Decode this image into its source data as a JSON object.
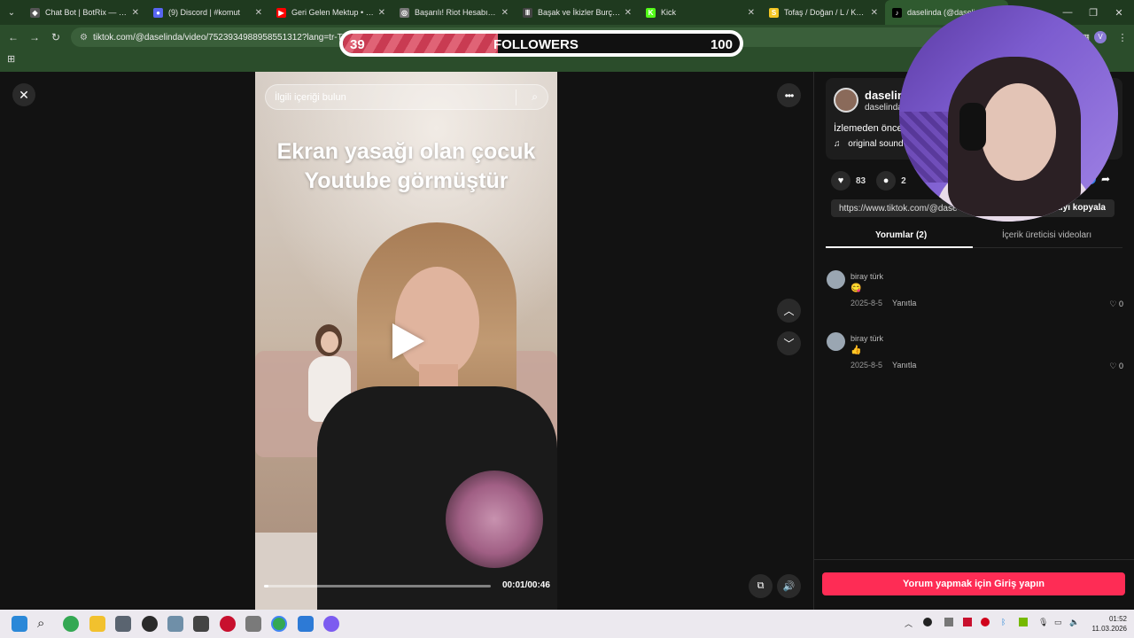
{
  "browser": {
    "tabs": [
      {
        "label": "Chat Bot | BotRix — Clou",
        "fav_color": "#555555",
        "fav_text": "◆"
      },
      {
        "label": "(9) Discord | #komut",
        "fav_color": "#5865f2",
        "fav_text": "●"
      },
      {
        "label": "Geri Gelen Mektup • Gülr",
        "fav_color": "#ff0000",
        "fav_text": "▶"
      },
      {
        "label": "Başarılı! Riot Hesabın Artık",
        "fav_color": "#777777",
        "fav_text": "◎"
      },
      {
        "label": "Başak ve İkizler Burç Uyum",
        "fav_color": "#444444",
        "fav_text": "Ⅲ"
      },
      {
        "label": "Kick",
        "fav_color": "#53fc18",
        "fav_text": "K"
      },
      {
        "label": "Tofaş / Doğan / L / Kusur",
        "fav_color": "#f3c623",
        "fav_text": "S"
      },
      {
        "label": "daselinda (@daselinda)",
        "fav_color": "#000000",
        "fav_text": "♪"
      }
    ],
    "url": "tiktok.com/@daselinda/video/7523934988958551312?lang=tr-TR"
  },
  "followers_goal": {
    "current": "39",
    "label": "FOLLOWERS",
    "goal": "100",
    "progress_fraction": 0.39
  },
  "video": {
    "search_placeholder": "İlgili içeriği bulun",
    "caption_line1": "Ekran yasağı olan çocuk",
    "caption_line2": "Youtube görmüştür",
    "time": "00:01/00:46",
    "progress_fraction": 0.02
  },
  "author": {
    "name": "daselin",
    "handle": "daselinda",
    "description": "İzlemeden önce",
    "sound": "original sound"
  },
  "stats": {
    "likes": "83",
    "comments": "2"
  },
  "link": {
    "url": "https://www.tiktok.com/@dase",
    "copy_label": "ıtıyı kopyala"
  },
  "panel_tabs": {
    "comments": "Yorumlar (2)",
    "creator_videos": "İçerik üreticisi videoları"
  },
  "comments": [
    {
      "author": "biray türk",
      "emoji": "😋",
      "date": "2025-8-5",
      "reply": "Yanıtla",
      "likes": "0"
    },
    {
      "author": "biray türk",
      "emoji": "👍",
      "date": "2025-8-5",
      "reply": "Yanıtla",
      "likes": "0"
    }
  ],
  "login_button": "Yorum yapmak için Giriş yapın",
  "clock": {
    "time": "01:52",
    "date": "11.03.2026"
  },
  "icons": {
    "close": "✕",
    "more": "•••",
    "up": "︿",
    "down": "﹀",
    "search": "⌕",
    "heart": "♥",
    "comment": "●",
    "share": "➦",
    "note": "♫",
    "like_outline": "♡"
  }
}
